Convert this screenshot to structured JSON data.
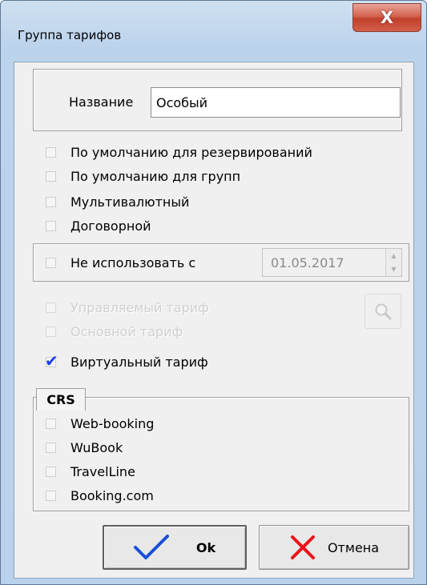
{
  "window": {
    "title": "Группа тарифов",
    "close_label": "X"
  },
  "name_field": {
    "label": "Название",
    "value": "Особый"
  },
  "options": [
    {
      "label": "По умолчанию для резервирований",
      "checked": false,
      "enabled": true
    },
    {
      "label": "По умолчанию для групп",
      "checked": false,
      "enabled": true
    },
    {
      "label": "Мультивалютный",
      "checked": false,
      "enabled": true
    },
    {
      "label": "Договорной",
      "checked": false,
      "enabled": true
    }
  ],
  "not_use_since": {
    "label": "Не использовать с",
    "checked": false,
    "date": "01.05.2017"
  },
  "tariff_options": [
    {
      "label": "Управляемый тариф",
      "checked": false,
      "enabled": false
    },
    {
      "label": "Основной тариф",
      "checked": false,
      "enabled": false
    },
    {
      "label": "Виртуальный тариф",
      "checked": true,
      "enabled": true
    }
  ],
  "crs": {
    "label": "CRS",
    "items": [
      {
        "label": "Web-booking",
        "checked": false
      },
      {
        "label": "WuBook",
        "checked": false
      },
      {
        "label": "TravelLine",
        "checked": false
      },
      {
        "label": "Booking.com",
        "checked": false
      }
    ]
  },
  "buttons": {
    "ok_label": "Ok",
    "cancel_label": "Отмена"
  },
  "colors": {
    "check": "#1b3ef0",
    "cancel_x": "#e8141a",
    "ok_check": "#1a4fd8"
  }
}
